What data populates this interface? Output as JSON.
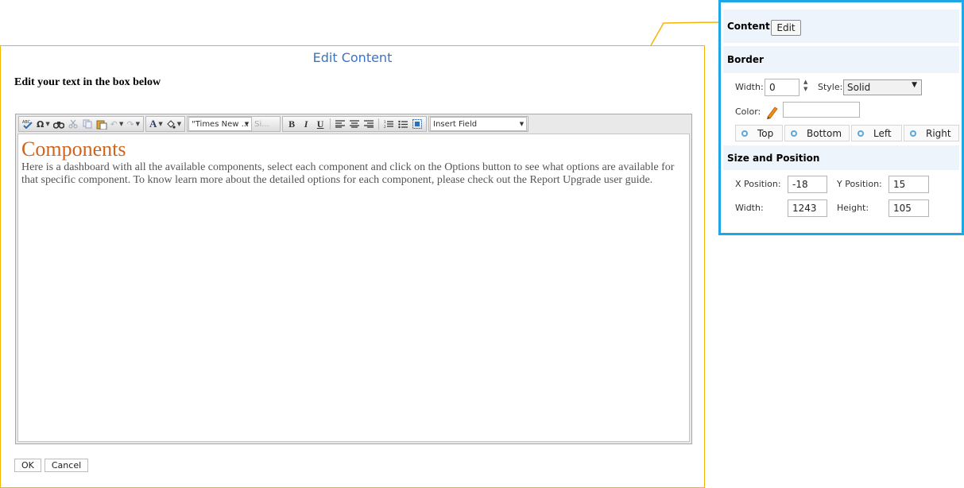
{
  "dialog": {
    "title": "Edit Content",
    "instruction": "Edit your text in the box below",
    "ok_label": "OK",
    "cancel_label": "Cancel"
  },
  "toolbar": {
    "font_name": "\"Times New ...",
    "font_size": "Si...",
    "insert_field": "Insert Field",
    "icons": [
      "spellcheck-icon",
      "omega-icon",
      "find-icon",
      "cut-icon",
      "copy-icon",
      "paste-icon",
      "undo-icon",
      "redo-icon",
      "font-color-icon",
      "highlight-icon",
      "bold-icon",
      "italic-icon",
      "underline-icon",
      "align-left-icon",
      "align-center-icon",
      "align-right-icon",
      "ordered-list-icon",
      "unordered-list-icon",
      "select-all-icon"
    ],
    "bold": "B",
    "italic": "I",
    "underline": "U",
    "font_color_glyph": "A",
    "omega_glyph": "Ω"
  },
  "editor": {
    "heading": "Components",
    "body": "Here is a dashboard with all the available components, select each component and click on the Options button to see what options are available for that specific component. To know learn more about the detailed options for each component, please check out the Report Upgrade user guide."
  },
  "panel": {
    "content_label": "Content",
    "edit_label": "Edit",
    "border_label": "Border",
    "width_label": "Width:",
    "width_value": "0",
    "style_label": "Style:",
    "style_value": "Solid",
    "color_label": "Color:",
    "color_value": "",
    "sides": [
      "Top",
      "Bottom",
      "Left",
      "Right"
    ],
    "size_position_label": "Size and Position",
    "x_label": "X Position:",
    "x_value": "-18",
    "y_label": "Y Position:",
    "y_value": "15",
    "w_label": "Width:",
    "w_value": "1243",
    "h_label": "Height:",
    "h_value": "105"
  },
  "colors": {
    "accent_panel": "#1ea7e6",
    "dialog_border": "#f5b400",
    "title": "#3a74c4",
    "heading": "#d0641e"
  }
}
